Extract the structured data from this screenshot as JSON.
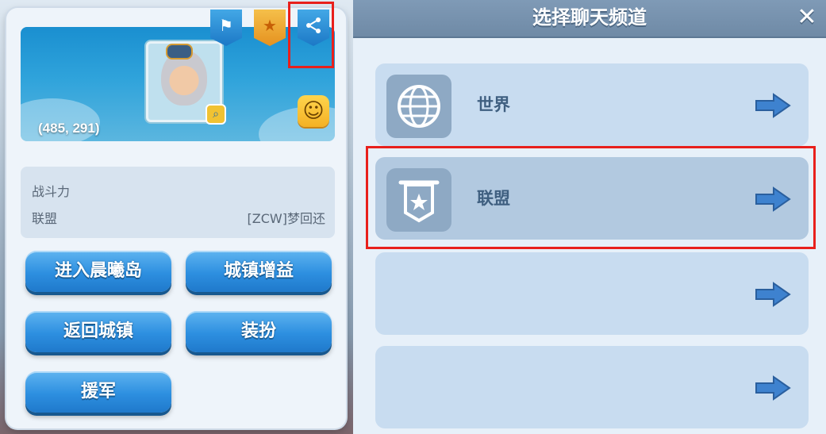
{
  "profile": {
    "coordinates": "(485, 291)",
    "info": {
      "power_label": "战斗力",
      "alliance_label": "联盟",
      "alliance_value": "[ZCW]梦回还"
    },
    "buttons": {
      "enter_island": "进入晨曦岛",
      "town_buff": "城镇增益",
      "return_town": "返回城镇",
      "dress_up": "装扮",
      "reinforce": "援军"
    },
    "badges": {
      "flag_icon": "flag-icon",
      "star_icon": "star-icon",
      "share_icon": "share-icon"
    }
  },
  "channel_select": {
    "title": "选择聊天频道",
    "close_label": "✕",
    "channels": [
      {
        "label": "世界",
        "icon": "globe-icon"
      },
      {
        "label": "联盟",
        "icon": "alliance-banner-icon"
      },
      {
        "label": "",
        "icon": ""
      },
      {
        "label": "",
        "icon": ""
      }
    ]
  },
  "colors": {
    "highlight": "#e8201c",
    "button_blue": "#2d8fe0",
    "row_bg": "#c8dcf0",
    "header_bg": "#7f9ab6"
  }
}
